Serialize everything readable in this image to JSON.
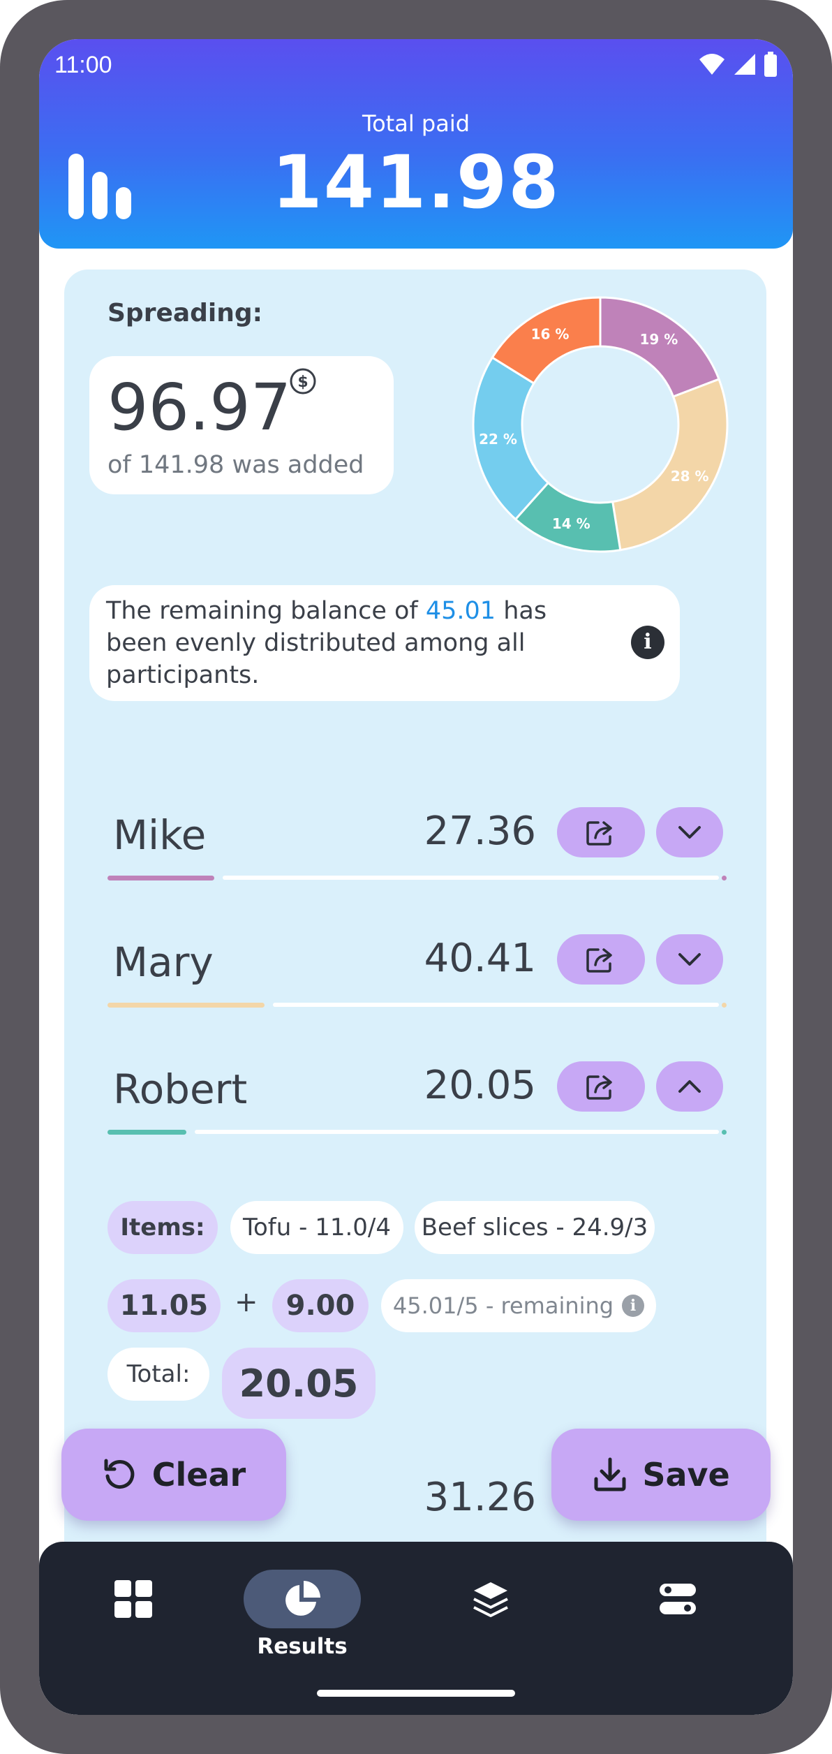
{
  "status_bar": {
    "time": "11:00"
  },
  "header": {
    "label": "Total paid",
    "total": "141.98"
  },
  "spreading": {
    "title": "Spreading:",
    "added_value": "96.97",
    "added_caption": "of 141.98 was added",
    "currency_icon": "dollar-circle-icon"
  },
  "chart_data": {
    "type": "pie",
    "style": "donut",
    "slices": [
      {
        "label": "19 %",
        "value": 19,
        "color": "#bf82b9"
      },
      {
        "label": "28 %",
        "value": 28,
        "color": "#f3d6a8"
      },
      {
        "label": "14 %",
        "value": 14,
        "color": "#58bfb0"
      },
      {
        "label": "22 %",
        "value": 22,
        "color": "#74cdee"
      },
      {
        "label": "16 %",
        "value": 16,
        "color": "#fa7f4c"
      }
    ]
  },
  "info": {
    "text_before": "The remaining balance of ",
    "highlight": "45.01",
    "text_after": " has been evenly distributed among all participants."
  },
  "people": [
    {
      "name": "Mike",
      "amount": "27.36",
      "color": "#bf82b9",
      "share": 0.19,
      "expanded": false
    },
    {
      "name": "Mary",
      "amount": "40.41",
      "color": "#f3d6a8",
      "share": 0.28,
      "expanded": false
    },
    {
      "name": "Robert",
      "amount": "20.05",
      "color": "#58bfb0",
      "share": 0.14,
      "expanded": true
    },
    {
      "name": "",
      "amount": "31.26",
      "color": "#74cdee",
      "share": 0.22,
      "expanded": false
    }
  ],
  "details": {
    "items_label": "Items:",
    "items": [
      "Tofu - 11.0/4",
      "Beef slices - 24.9/3"
    ],
    "items_sum": "11.05",
    "plus": "+",
    "remaining_share": "9.00",
    "remaining_text": "45.01/5 - remaining",
    "total_label": "Total:",
    "total": "20.05"
  },
  "actions": {
    "clear": "Clear",
    "save": "Save"
  },
  "nav": {
    "items": [
      {
        "icon": "grid-icon",
        "label": "",
        "active": false
      },
      {
        "icon": "pie-chart-icon",
        "label": "Results",
        "active": true
      },
      {
        "icon": "layers-icon",
        "label": "",
        "active": false
      },
      {
        "icon": "settings-toggle-icon",
        "label": "",
        "active": false
      }
    ]
  }
}
